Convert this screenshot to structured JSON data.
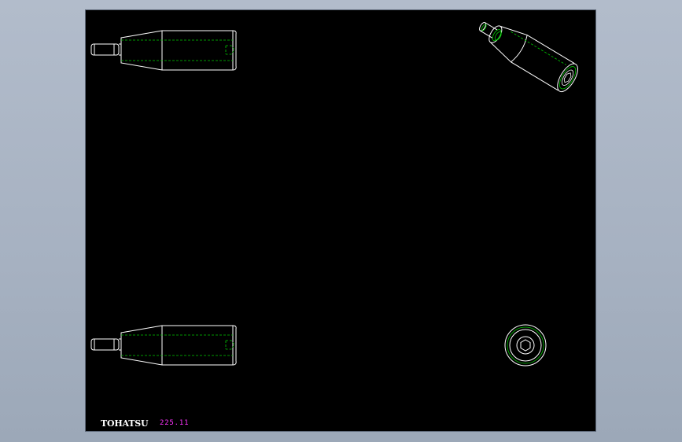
{
  "title_block": {
    "brand": "TOHATSU",
    "part_number": "225.11"
  },
  "colors": {
    "background": "#000000",
    "outline": "#ffffff",
    "hidden_line": "#00c800",
    "annotation": "#ff33ff",
    "frame": "#a9b3c3"
  },
  "views": [
    {
      "name": "side-view-top",
      "type": "handle-side"
    },
    {
      "name": "side-view-bottom",
      "type": "handle-side"
    },
    {
      "name": "isometric-view",
      "type": "handle-iso"
    },
    {
      "name": "end-view",
      "type": "handle-end"
    }
  ]
}
